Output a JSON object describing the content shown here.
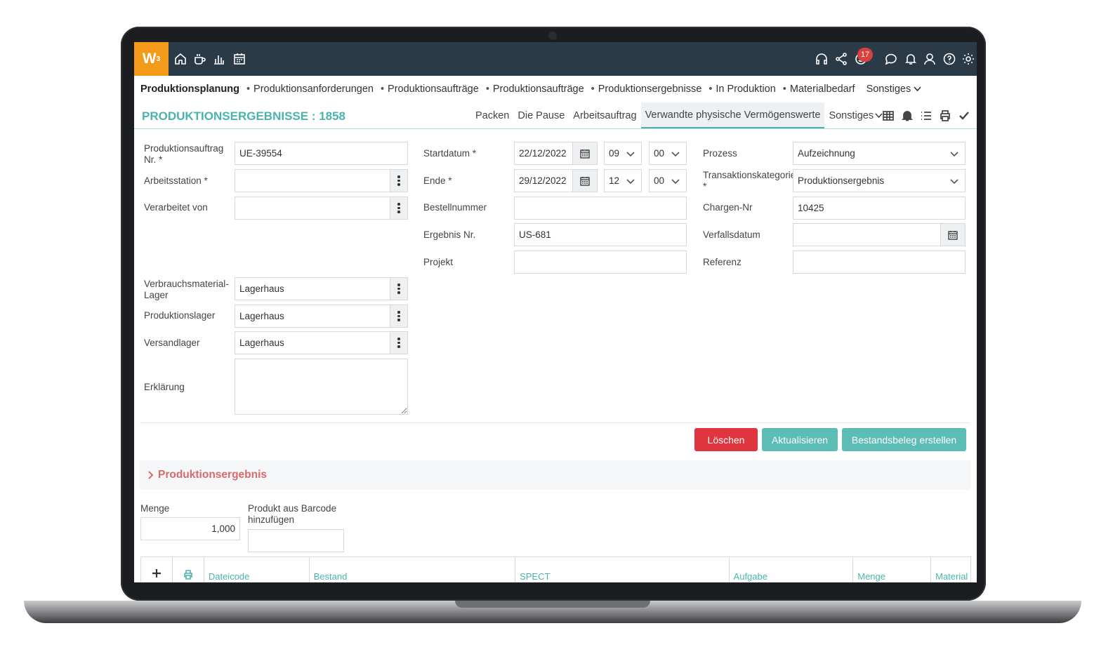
{
  "app": {
    "logo_text": "W",
    "logo_sup": "3",
    "notification_count": "17"
  },
  "menu": {
    "active": "Produktionsplanung",
    "items": [
      "Produktionsanforderungen",
      "Produktionsaufträge",
      "Produktionsaufträge",
      "Produktionsergebnisse",
      "In Produktion",
      "Materialbedarf"
    ],
    "more": "Sonstiges"
  },
  "title": "PRODUKTIONSERGEBNISSE : 1858",
  "tabs": [
    "Packen",
    "Die Pause",
    "Arbeitsauftrag",
    "Verwandte physische Vermögenswerte",
    "Sonstiges"
  ],
  "form": {
    "order_no": {
      "label1": "Produktionsauftrag",
      "label2": "Nr. *",
      "value": "UE-39554"
    },
    "workstation": {
      "label": "Arbeitsstation *",
      "value": ""
    },
    "processed_by": {
      "label": "Verarbeitet von",
      "value": ""
    },
    "consumable_store": {
      "label1": "Verbrauchsmaterial-",
      "label2": "Lager",
      "value": "Lagerhaus"
    },
    "production_store": {
      "label": "Produktionslager",
      "value": "Lagerhaus"
    },
    "shipping_store": {
      "label": "Versandlager",
      "value": "Lagerhaus"
    },
    "explanation": {
      "label": "Erklärung",
      "value": ""
    },
    "start": {
      "label": "Startdatum *",
      "date": "22/12/2022",
      "hour": "09",
      "minute": "00"
    },
    "end": {
      "label": "Ende *",
      "date": "29/12/2022",
      "hour": "12",
      "minute": "00"
    },
    "order_number": {
      "label": "Bestellnummer",
      "value": ""
    },
    "result_no": {
      "label": "Ergebnis Nr.",
      "value": "US-681"
    },
    "project": {
      "label": "Projekt",
      "value": ""
    },
    "process": {
      "label": "Prozess",
      "value": "Aufzeichnung"
    },
    "transaction_category": {
      "label1": "Transaktionskategorie",
      "label2": "*",
      "value": "Produktionsergebnis"
    },
    "batch_no": {
      "label": "Chargen-Nr",
      "value": "10425"
    },
    "expiry": {
      "label": "Verfallsdatum",
      "value": ""
    },
    "reference": {
      "label": "Referenz",
      "value": ""
    }
  },
  "buttons": {
    "delete": "Löschen",
    "update": "Aktualisieren",
    "create": "Bestandsbeleg erstellen"
  },
  "section": {
    "title": "Produktionsergebnis"
  },
  "quantity": {
    "label": "Menge",
    "value": "1,000"
  },
  "barcode": {
    "label1": "Produkt aus Barcode",
    "label2": "hinzufügen",
    "value": ""
  },
  "grid": {
    "columns": [
      "Dateicode",
      "Bestand",
      "SPECT",
      "Aufgabe",
      "Menge",
      "Material"
    ]
  },
  "colors": {
    "topbar": "#2b3a47",
    "logo": "#f49a1a",
    "accent": "#4bb3ad",
    "danger": "#e0353f",
    "section_title": "#d66b6b"
  }
}
